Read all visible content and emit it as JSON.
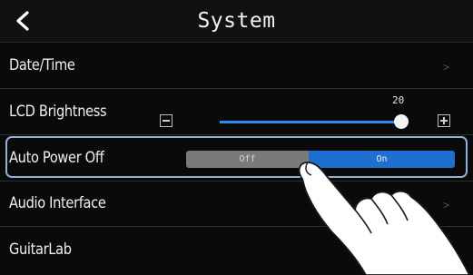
{
  "header": {
    "title": "System",
    "back_icon": "chevron-left-icon"
  },
  "rows": [
    {
      "label": "Date/Time",
      "chevron": ">"
    },
    {
      "label": "LCD Brightness",
      "value": "20",
      "level_fraction": 1.0
    },
    {
      "label": "Auto Power Off",
      "options": [
        "Off",
        "On"
      ],
      "selected": "On"
    },
    {
      "label": "Audio Interface",
      "chevron": ">"
    },
    {
      "label": "GuitarLab"
    }
  ],
  "colors": {
    "background": "#0a0a0a",
    "accent_blue": "#1f6fd0",
    "off_gray": "#7a7a7a",
    "highlight_border": "#8fb2d8"
  }
}
